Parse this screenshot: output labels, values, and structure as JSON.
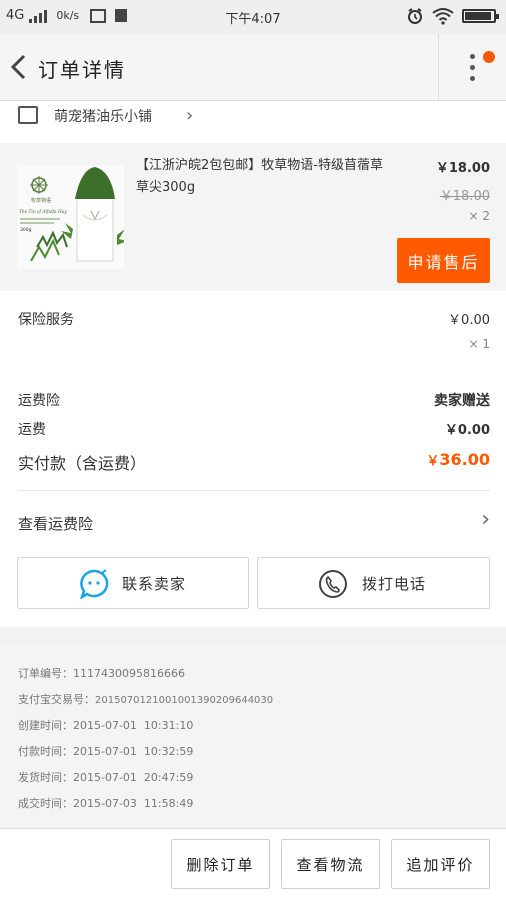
{
  "status_bar": {
    "network": "4G",
    "speed": "0k/s",
    "time": "下午4:07"
  },
  "header": {
    "title": "订单详情"
  },
  "shop": {
    "name": "萌宠猪油乐小铺"
  },
  "product": {
    "title": "【江浙沪皖2包包邮】牧草物语-特级苜蓿草草尖300g",
    "price": "￥18.00",
    "original_price": "￥18.00",
    "quantity": "× 2",
    "after_sale_label": "申请售后",
    "package_text": {
      "brand": "牧草物语",
      "tagline": "The Tip of Alfalfa Hay",
      "weight": "300g"
    }
  },
  "summary": {
    "insurance_label": "保险服务",
    "insurance_value": "￥0.00",
    "insurance_qty": "× 1",
    "freight_insurance_label": "运费险",
    "freight_insurance_value": "卖家赠送",
    "shipping_label": "运费",
    "shipping_value": "￥0.00",
    "paid_label": "实付款（含运费）",
    "paid_currency": "￥",
    "paid_value": "36.00",
    "view_insurance_label": "查看运费险",
    "contact_seller_label": "联系卖家",
    "call_label": "拨打电话"
  },
  "order_info": [
    {
      "label": "订单编号：",
      "value": "1117430095816666"
    },
    {
      "label": "支付宝交易号：",
      "value": "2015070121001001390209644030"
    },
    {
      "label": "创建时间：",
      "value": "2015-07-01  10:31:10"
    },
    {
      "label": "付款时间：",
      "value": "2015-07-01  10:32:59"
    },
    {
      "label": "发货时间：",
      "value": "2015-07-01  20:47:59"
    },
    {
      "label": "成交时间：",
      "value": "2015-07-03  11:58:49"
    }
  ],
  "footer": {
    "delete_label": "删除订单",
    "logistics_label": "查看物流",
    "review_label": "追加评价"
  },
  "colors": {
    "accent": "#ff5a00",
    "badge": "#f55a00",
    "chat_icon": "#1aa3e8"
  }
}
